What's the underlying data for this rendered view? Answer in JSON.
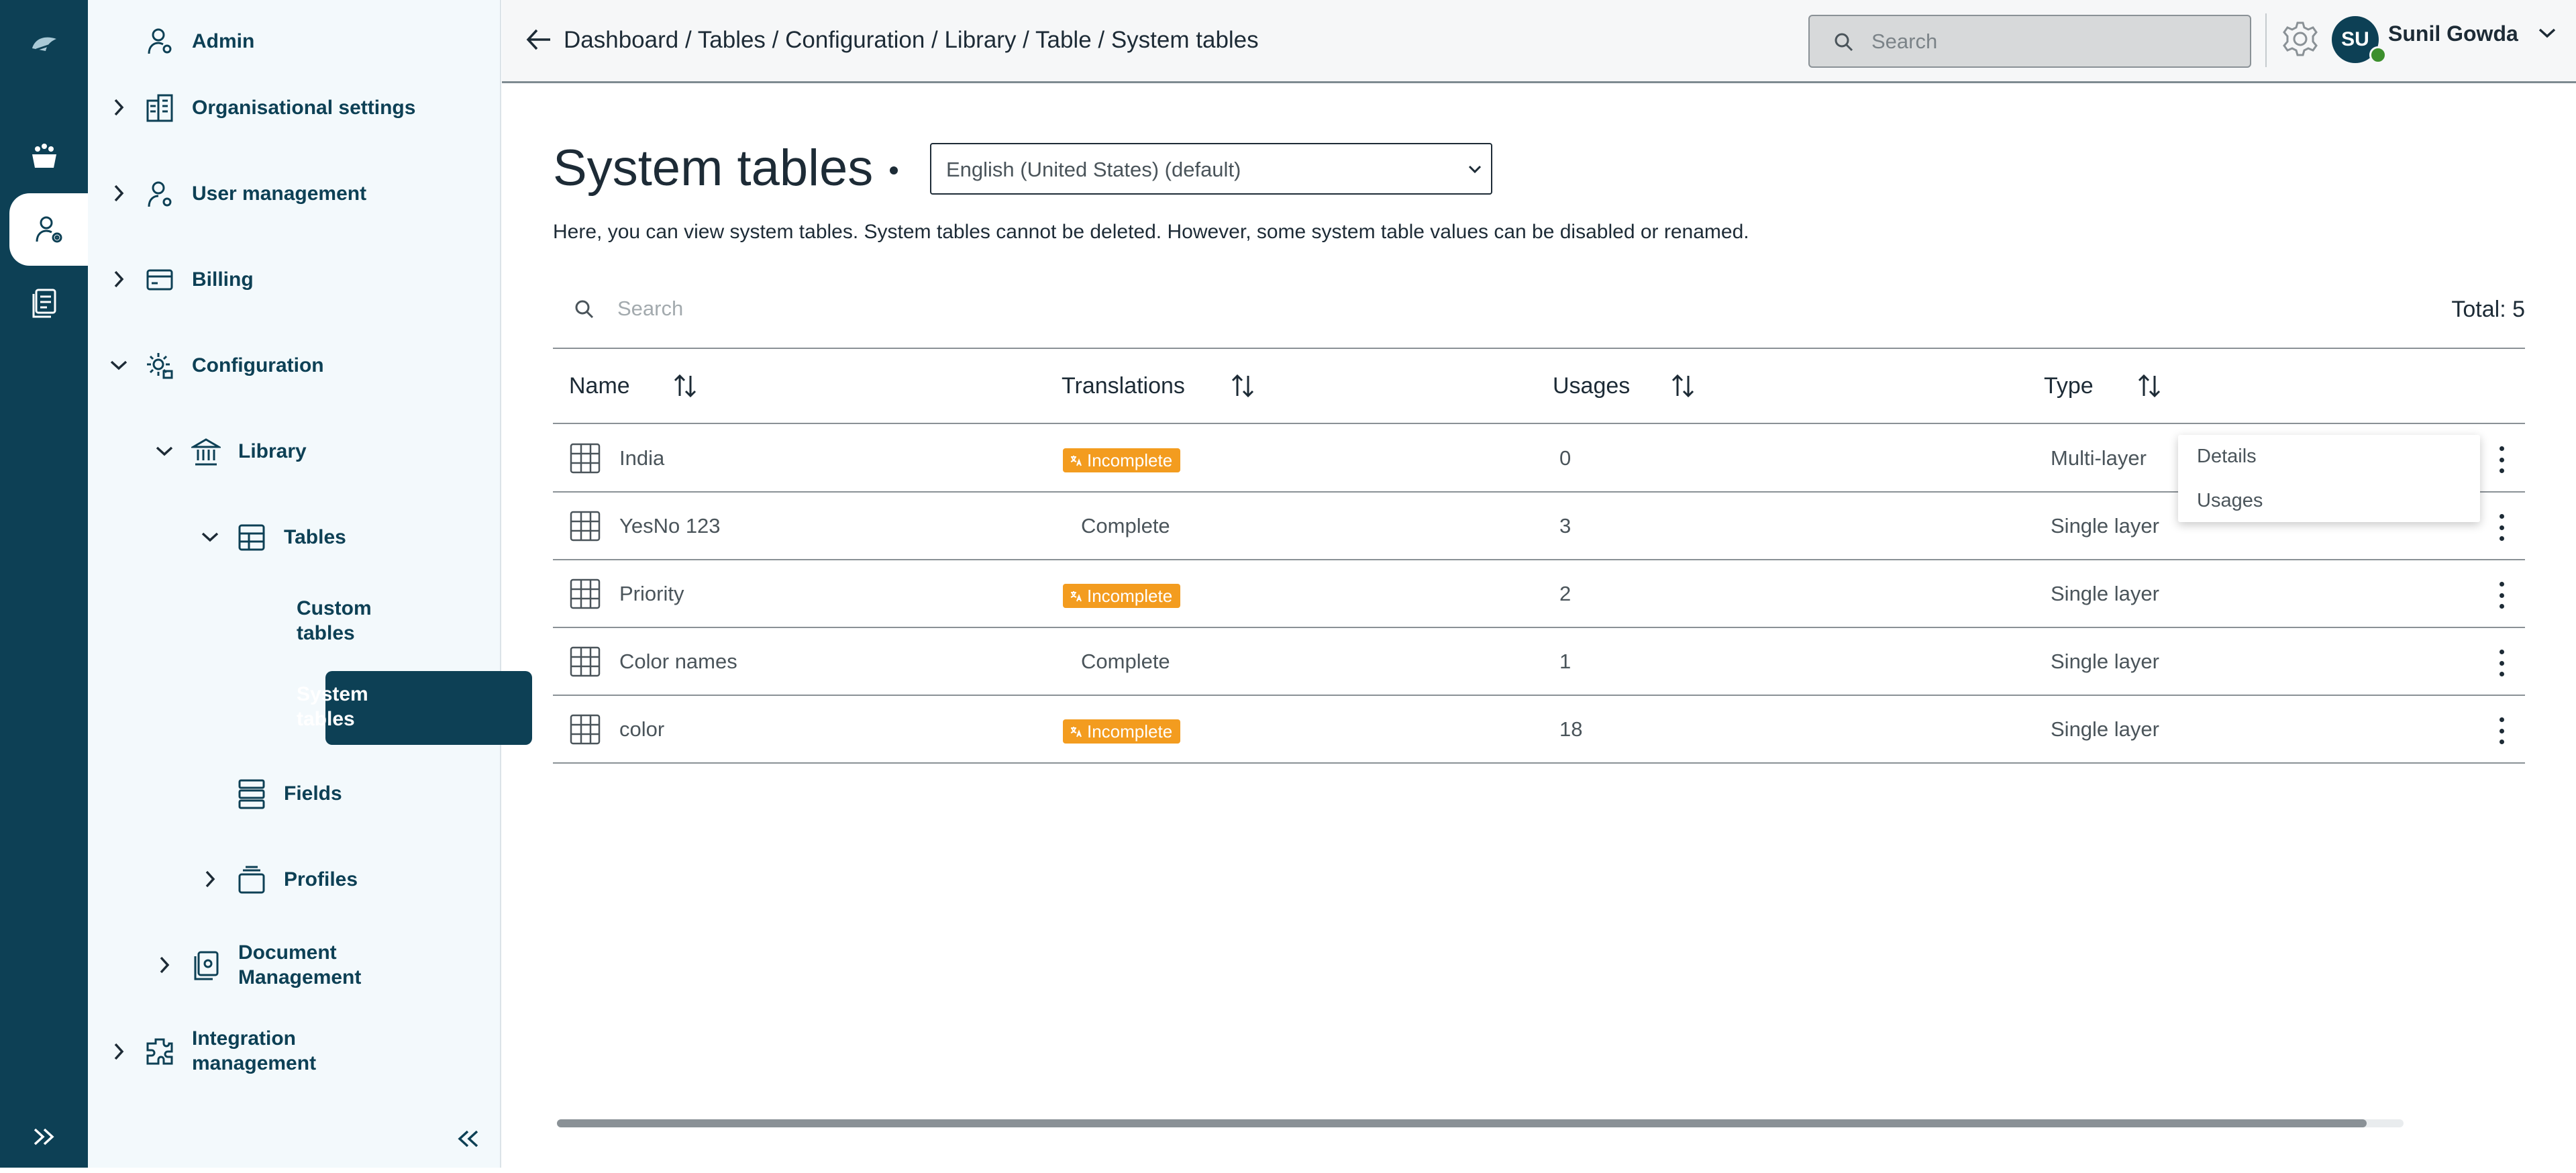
{
  "sidebar": {
    "title": "Admin",
    "items": [
      {
        "label": "Organisational settings"
      },
      {
        "label": "User management"
      },
      {
        "label": "Billing"
      },
      {
        "label": "Configuration"
      },
      {
        "label": "Library"
      },
      {
        "label": "Tables"
      },
      {
        "label_line1": "Custom",
        "label_line2": "tables"
      },
      {
        "label_line1": "System",
        "label_line2": "tables"
      },
      {
        "label": "Fields"
      },
      {
        "label": "Profiles"
      },
      {
        "label_line1": "Document",
        "label_line2": "Management"
      },
      {
        "label_line1": "Integration",
        "label_line2": "management"
      }
    ]
  },
  "header": {
    "breadcrumb": "Dashboard / Tables / Configuration / Library / Table / System tables",
    "search_placeholder": "Search",
    "user_initials": "SU",
    "user_name": "Sunil Gowda"
  },
  "main": {
    "title": "System tables",
    "language": "English (United States) (default)",
    "description": "Here, you can view system tables. System tables cannot be deleted. However, some system table values can be disabled or renamed.",
    "search_placeholder": "Search",
    "total": "Total: 5",
    "columns": [
      "Name",
      "Translations",
      "Usages",
      "Type"
    ],
    "rows": [
      {
        "name": "India",
        "translation": "Incomplete",
        "usages": "0",
        "type": "Multi-layer"
      },
      {
        "name": "YesNo 123",
        "translation": "Complete",
        "usages": "3",
        "type": "Single layer"
      },
      {
        "name": "Priority",
        "translation": "Incomplete",
        "usages": "2",
        "type": "Single layer"
      },
      {
        "name": "Color names",
        "translation": "Complete",
        "usages": "1",
        "type": "Single layer"
      },
      {
        "name": "color",
        "translation": "Incomplete",
        "usages": "18",
        "type": "Single layer"
      }
    ],
    "context_menu": [
      "Details",
      "Usages"
    ]
  },
  "colors": {
    "brand": "#0d4055",
    "warning": "#f39c1f",
    "online": "#3c8f2d"
  },
  "horizontal_scroll_fraction": 0.98
}
